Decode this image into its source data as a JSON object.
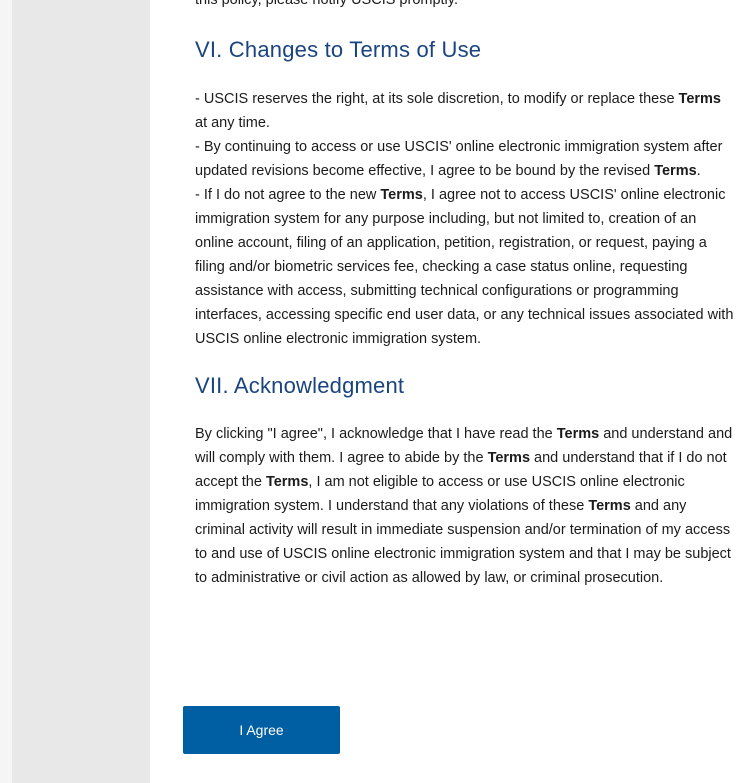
{
  "top_cutoff_text": "this policy, please notify USCIS promptly.",
  "section6": {
    "heading": "VI. Changes to Terms of Use",
    "b1_pre": " - USCIS reserves the right, at its sole discretion, to modify or replace these ",
    "b1_bold": "Terms",
    "b1_post": " at any time.",
    "b2_pre": " - By continuing to access or use USCIS' online electronic immigration system after updated revisions become effective, I agree to be bound by the revised ",
    "b2_bold": "Terms",
    "b2_post": ".",
    "b3_pre": " - If I do not agree to the new ",
    "b3_bold": "Terms",
    "b3_post": ", I agree not to access USCIS' online electronic immigration system for any purpose including, but not limited to, creation of an online account, filing of an application, petition, registration, or request, paying a filing and/or biometric services fee, checking a case status online, requesting assistance with access, submitting technical configurations or programming interfaces, accessing specific end user data, or any technical issues associated with USCIS online electronic immigration system."
  },
  "section7": {
    "heading": "VII. Acknowledgment",
    "p_1": "By clicking \"I agree\", I acknowledge that I have read the ",
    "p_2": "Terms",
    "p_3": " and understand and will comply with them. I agree to abide by the ",
    "p_4": "Terms",
    "p_5": " and understand that if I do not accept the ",
    "p_6": "Terms",
    "p_7": ", I am not eligible to access or use USCIS online electronic immigration system. I understand that any violations of these ",
    "p_8": "Terms",
    "p_9": " and any criminal activity will result in immediate suspension and/or termination of my access to and use of USCIS online electronic immigration system and that I may be subject to administrative or civil action as allowed by law, or criminal prosecution."
  },
  "agree_button": "I Agree",
  "colors": {
    "heading": "#1a4480",
    "button_bg": "#005ea2",
    "page_bg": "#e8e8e8",
    "panel_bg": "#ffffff"
  }
}
